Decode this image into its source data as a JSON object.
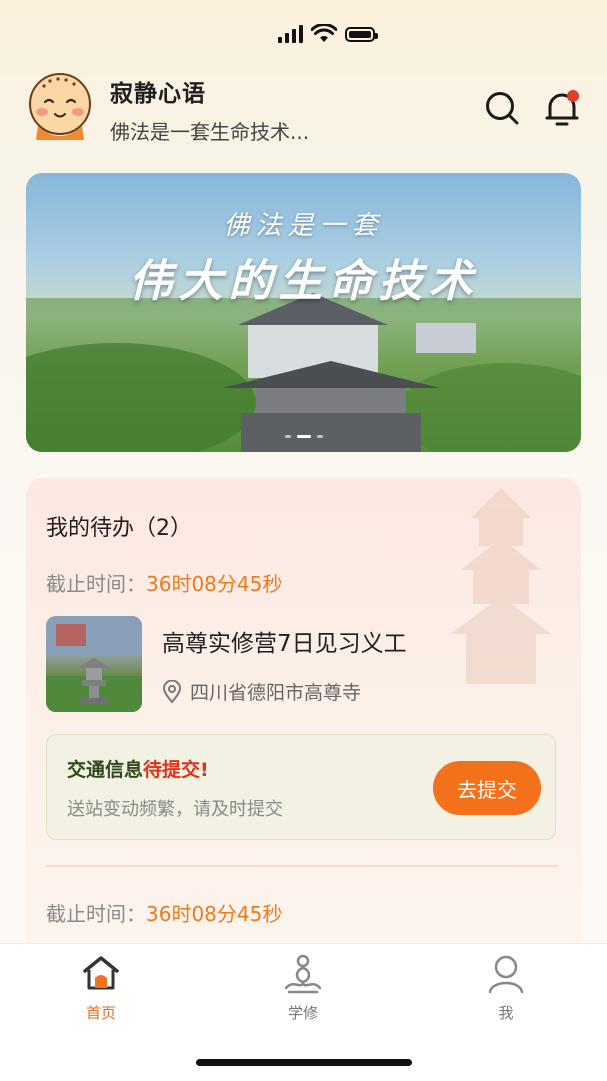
{
  "status_bar": {
    "icons": [
      "signal-icon",
      "wifi-icon",
      "battery-icon"
    ]
  },
  "header": {
    "user_name": "寂静心语",
    "user_subtitle": "佛法是一套生命技术...",
    "icons": [
      "avatar",
      "search-icon",
      "bell-icon"
    ],
    "notification_dot_color": "#e53b2b"
  },
  "banner": {
    "line1": "佛法是一套",
    "line2": "伟大的生命技术",
    "page_count": 3,
    "active_page": 2
  },
  "todo": {
    "title": "我的待办（2）",
    "items": [
      {
        "deadline_label": "截止时间：",
        "deadline_value": "36时08分45秒",
        "event_title": "高尊实修营7日见习义工",
        "location": "四川省德阳市高尊寺",
        "notice_prefix": "交通信息",
        "notice_status": "待提交!",
        "notice_desc": "送站变动频繁，请及时提交",
        "action_label": "去提交"
      },
      {
        "deadline_label": "截止时间：",
        "deadline_value": "36时08分45秒"
      }
    ]
  },
  "tabbar": {
    "tabs": [
      {
        "label": "首页",
        "icon": "home-icon",
        "active": true
      },
      {
        "label": "学修",
        "icon": "meditation-icon",
        "active": false
      },
      {
        "label": "我",
        "icon": "profile-icon",
        "active": false
      }
    ]
  },
  "colors": {
    "accent": "#f4711c",
    "deadline": "#f07a1a",
    "warning": "#e0311b",
    "tab_active": "#e86d1d"
  }
}
